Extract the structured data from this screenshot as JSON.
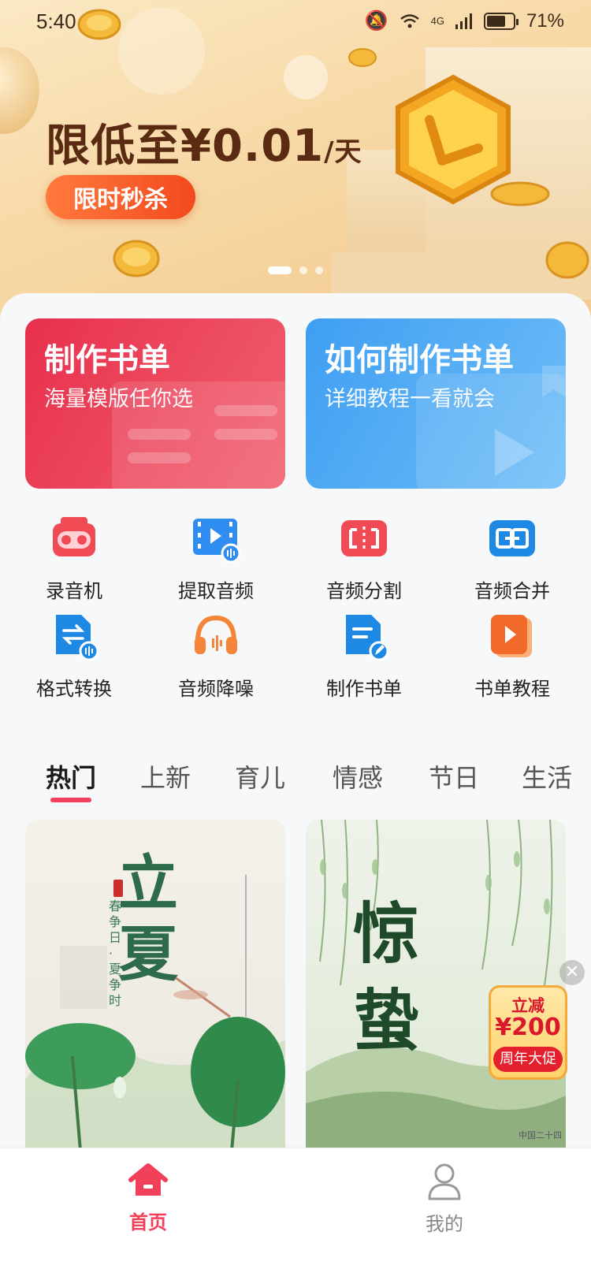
{
  "status_bar": {
    "time": "5:40",
    "network": "4G",
    "battery": "71%"
  },
  "banner": {
    "promo_text": "限低至¥0.01",
    "promo_unit": "/天",
    "cta_label": "限时秒杀",
    "carousel_pages": 3,
    "carousel_active": 1
  },
  "cards": [
    {
      "title": "制作书单",
      "subtitle": "海量模版任你选",
      "color": "#e8304d"
    },
    {
      "title": "如何制作书单",
      "subtitle": "详细教程一看就会",
      "color": "#3f9ef2"
    }
  ],
  "tools": [
    {
      "label": "录音机",
      "icon": "recorder-icon"
    },
    {
      "label": "提取音频",
      "icon": "extract-audio-icon"
    },
    {
      "label": "音频分割",
      "icon": "audio-split-icon"
    },
    {
      "label": "音频合并",
      "icon": "audio-merge-icon"
    },
    {
      "label": "格式转换",
      "icon": "format-convert-icon"
    },
    {
      "label": "音频降噪",
      "icon": "noise-reduction-icon"
    },
    {
      "label": "制作书单",
      "icon": "make-booklist-icon"
    },
    {
      "label": "书单教程",
      "icon": "booklist-tutorial-icon"
    }
  ],
  "categories": [
    "热门",
    "上新",
    "育儿",
    "情感",
    "节日",
    "生活"
  ],
  "active_category": "热门",
  "templates": [
    {
      "title": "立夏",
      "side_text": "春争日·夏争时"
    },
    {
      "title": "惊蛰",
      "footer_text": "中国二十四"
    }
  ],
  "floating_promo": {
    "line1": "立减",
    "line2": "¥200",
    "line3": "周年大促"
  },
  "bottom_nav": {
    "home_label": "首页",
    "me_label": "我的"
  },
  "colors": {
    "accent": "#f0405a",
    "banner_cta": "#f24a1e",
    "card_red": "#e8304d",
    "card_blue": "#3f9ef2"
  }
}
